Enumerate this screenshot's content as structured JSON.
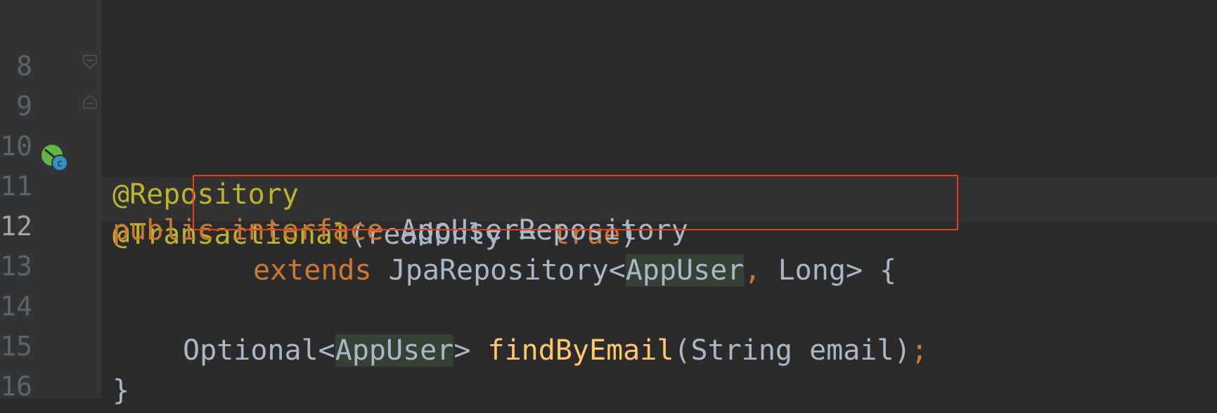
{
  "editor": {
    "lines": [
      {
        "number": "8",
        "segments": []
      },
      {
        "number": "9",
        "segments": [
          {
            "text": "@Repository"
          }
        ]
      },
      {
        "number": "10",
        "segments": [
          {
            "text": "@Transactional"
          },
          {
            "text": "(readOnly = "
          },
          {
            "text": "true"
          },
          {
            "text": ")"
          }
        ]
      },
      {
        "number": "11",
        "segments": [
          {
            "text": "public "
          },
          {
            "text": "interface "
          },
          {
            "text": "AppUserRepository"
          }
        ]
      },
      {
        "number": "12",
        "segments": [
          {
            "text": "extends "
          },
          {
            "text": "JpaRepository<"
          },
          {
            "text": "AppUser"
          },
          {
            "text": ","
          },
          {
            "text": " Long> {"
          }
        ]
      },
      {
        "number": "13",
        "segments": []
      },
      {
        "number": "14",
        "segments": [
          {
            "text": "Optional<"
          },
          {
            "text": "AppUser"
          },
          {
            "text": "> "
          },
          {
            "text": "findByEmail"
          },
          {
            "text": "(String email)"
          },
          {
            "text": ";"
          }
        ]
      },
      {
        "number": "15",
        "segments": [
          {
            "text": "}"
          }
        ]
      },
      {
        "number": "16",
        "segments": []
      }
    ],
    "gutter_icon": "implemented-interface-icon",
    "gutter_icon_letter": "c",
    "colors": {
      "background": "#2b2b2c",
      "annotation": "#bbb529",
      "keyword": "#cc7832",
      "method": "#ffc66d",
      "text": "#a9b7c6",
      "highlight_box": "#e8401c"
    }
  }
}
